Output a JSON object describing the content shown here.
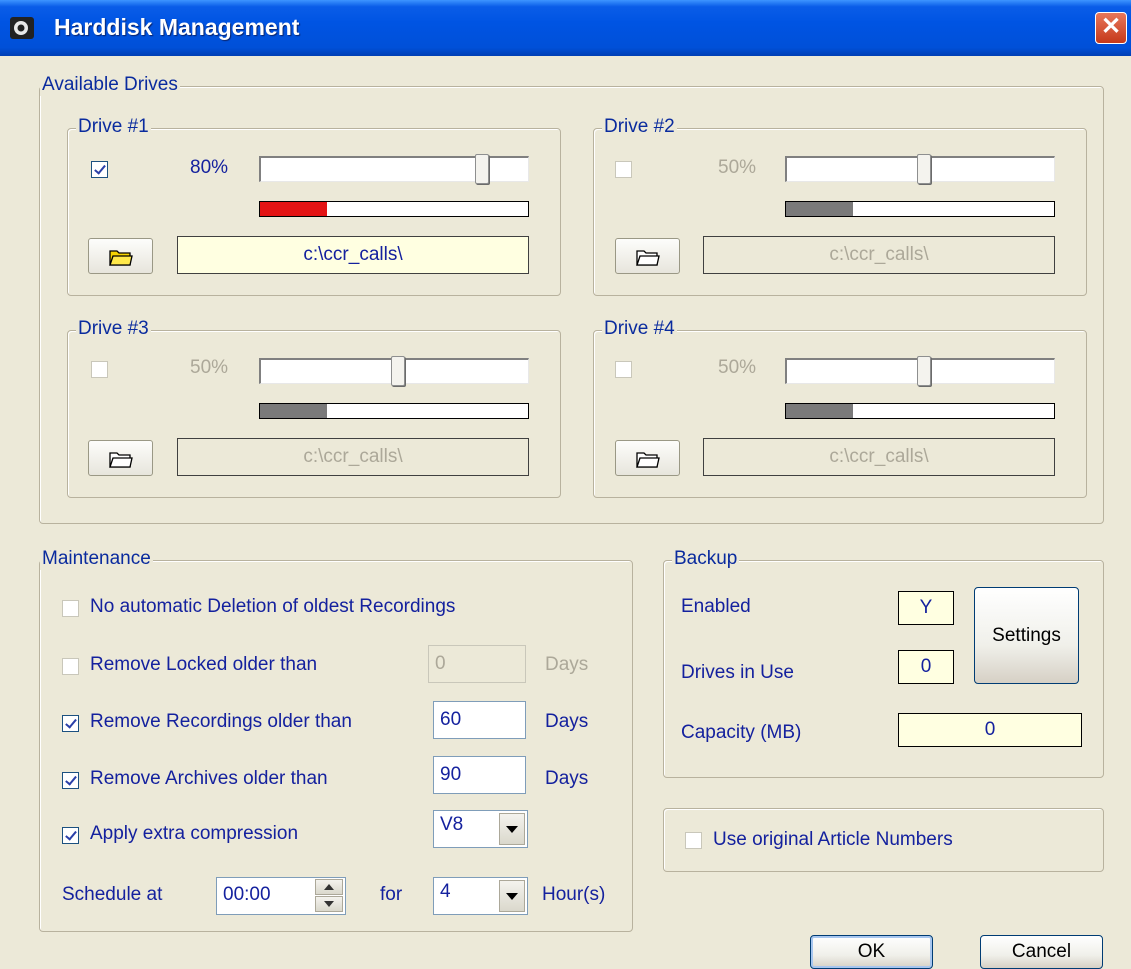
{
  "window": {
    "title": "Harddisk Management",
    "close_label": "✕"
  },
  "drives_group": {
    "legend": "Available Drives"
  },
  "drives": [
    {
      "legend": "Drive #1",
      "checked": true,
      "enabled": true,
      "percent_label": "80%",
      "slider_value": 0.8,
      "usage_fraction": 0.25,
      "usage_color": "#E31414",
      "path": "c:\\ccr_calls\\"
    },
    {
      "legend": "Drive #2",
      "checked": false,
      "enabled": false,
      "percent_label": "50%",
      "slider_value": 0.5,
      "usage_fraction": 0.25,
      "usage_color": "#7A7A7A",
      "path": "c:\\ccr_calls\\"
    },
    {
      "legend": "Drive #3",
      "checked": false,
      "enabled": false,
      "percent_label": "50%",
      "slider_value": 0.5,
      "usage_fraction": 0.25,
      "usage_color": "#7A7A7A",
      "path": "c:\\ccr_calls\\"
    },
    {
      "legend": "Drive #4",
      "checked": false,
      "enabled": false,
      "percent_label": "50%",
      "slider_value": 0.5,
      "usage_fraction": 0.25,
      "usage_color": "#7A7A7A",
      "path": "c:\\ccr_calls\\"
    }
  ],
  "maintenance": {
    "legend": "Maintenance",
    "no_auto_delete": {
      "label": "No automatic Deletion of oldest Recordings",
      "checked": false
    },
    "remove_locked": {
      "label": "Remove Locked older than",
      "checked": false,
      "value": "0",
      "unit": "Days"
    },
    "remove_recordings": {
      "label": "Remove Recordings older than",
      "checked": true,
      "value": "60",
      "unit": "Days"
    },
    "remove_archives": {
      "label": "Remove Archives older than",
      "checked": true,
      "value": "90",
      "unit": "Days"
    },
    "extra_compression": {
      "label": "Apply extra compression",
      "checked": true,
      "value": "V8"
    },
    "schedule": {
      "label": "Schedule at",
      "time": "00:00",
      "for_label": "for",
      "hours": "4",
      "unit": "Hour(s)"
    }
  },
  "backup": {
    "legend": "Backup",
    "enabled_label": "Enabled",
    "enabled_value": "Y",
    "drives_label": "Drives in Use",
    "drives_value": "0",
    "capacity_label": "Capacity (MB)",
    "capacity_value": "0",
    "settings_label": "Settings"
  },
  "article_numbers": {
    "label": "Use original Article Numbers",
    "checked": false
  },
  "buttons": {
    "ok": "OK",
    "cancel": "Cancel"
  },
  "colors": {
    "label_text": "#14219E",
    "disabled_text": "#ACA899",
    "title_bar": "#0054E3"
  }
}
